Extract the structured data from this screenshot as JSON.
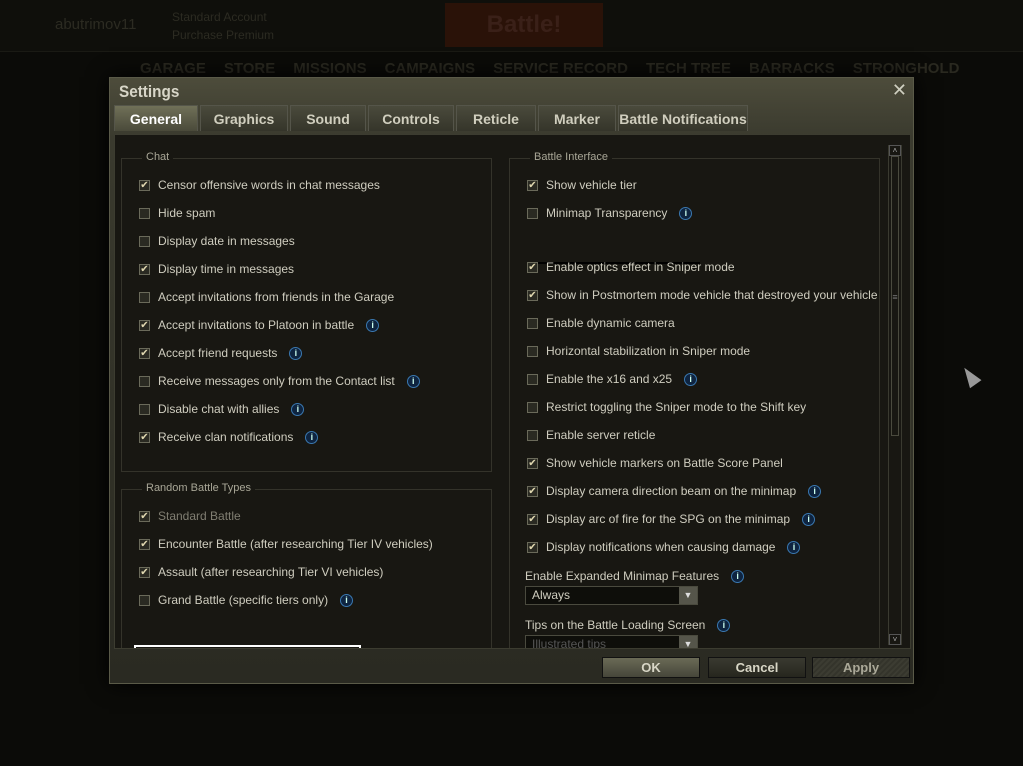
{
  "background": {
    "username": "abutrimov11",
    "account": "Standard Account",
    "premium": "Purchase Premium",
    "battle": "Battle!",
    "nav": [
      "GARAGE",
      "STORE",
      "MISSIONS",
      "CAMPAIGNS",
      "SERVICE RECORD",
      "TECH TREE",
      "BARRACKS",
      "STRONGHOLD"
    ]
  },
  "dialog": {
    "title": "Settings",
    "close_icon": "close-icon",
    "tabs": [
      "General",
      "Graphics",
      "Sound",
      "Controls",
      "Reticle",
      "Marker",
      "Battle Notifications"
    ],
    "active_tab": "General"
  },
  "chat": {
    "label": "Chat",
    "items": [
      {
        "label": "Censor offensive words in chat messages",
        "checked": true,
        "info": false
      },
      {
        "label": "Hide spam",
        "checked": false,
        "info": false
      },
      {
        "label": "Display date in messages",
        "checked": false,
        "info": false
      },
      {
        "label": "Display time in messages",
        "checked": true,
        "info": false
      },
      {
        "label": "Accept invitations from friends in the Garage",
        "checked": false,
        "info": false
      },
      {
        "label": "Accept invitations to Platoon in battle",
        "checked": true,
        "info": true
      },
      {
        "label": "Accept friend requests",
        "checked": true,
        "info": true
      },
      {
        "label": "Receive messages only from the Contact list",
        "checked": false,
        "info": true
      },
      {
        "label": "Disable chat with allies",
        "checked": false,
        "info": true
      },
      {
        "label": "Receive clan notifications",
        "checked": true,
        "info": true
      }
    ]
  },
  "random_battle": {
    "label": "Random Battle Types",
    "items": [
      {
        "label": "Standard Battle",
        "checked": true,
        "info": false,
        "disabled": true
      },
      {
        "label": "Encounter Battle (after researching Tier IV vehicles)",
        "checked": true,
        "info": false
      },
      {
        "label": "Assault (after researching Tier VI vehicles)",
        "checked": true,
        "info": false
      },
      {
        "label": "Grand Battle (specific tiers only)",
        "checked": false,
        "info": true
      }
    ]
  },
  "battle_interface": {
    "label": "Battle Interface",
    "items": [
      {
        "label": "Show vehicle tier",
        "checked": true,
        "info": false
      },
      {
        "label": "Minimap Transparency",
        "checked": false,
        "info": true
      },
      {
        "label": "Enable optics effect in Sniper mode",
        "checked": true,
        "info": false
      },
      {
        "label": "Show in Postmortem mode vehicle that destroyed your vehicle",
        "checked": true,
        "info": false
      },
      {
        "label": "Enable dynamic camera",
        "checked": false,
        "info": false
      },
      {
        "label": "Horizontal stabilization in Sniper mode",
        "checked": false,
        "info": false
      },
      {
        "label": "Enable the x16 and x25",
        "checked": false,
        "info": true
      },
      {
        "label": "Restrict toggling the Sniper mode to the Shift key",
        "checked": false,
        "info": false
      },
      {
        "label": "Enable server reticle",
        "checked": false,
        "info": false
      },
      {
        "label": "Show vehicle markers on Battle Score Panel",
        "checked": true,
        "info": false
      },
      {
        "label": "Display camera direction beam on the minimap",
        "checked": true,
        "info": true
      },
      {
        "label": "Display arc of fire for the SPG on the minimap",
        "checked": true,
        "info": true
      },
      {
        "label": "Display notifications when causing damage",
        "checked": true,
        "info": true
      }
    ],
    "minimap_label": "Enable Expanded Minimap Features",
    "minimap_value": "Always",
    "tips_label": "Tips on the Battle Loading Screen",
    "tips_value": "Illustrated tips"
  },
  "buttons": {
    "ok": "OK",
    "cancel": "Cancel",
    "apply": "Apply"
  }
}
